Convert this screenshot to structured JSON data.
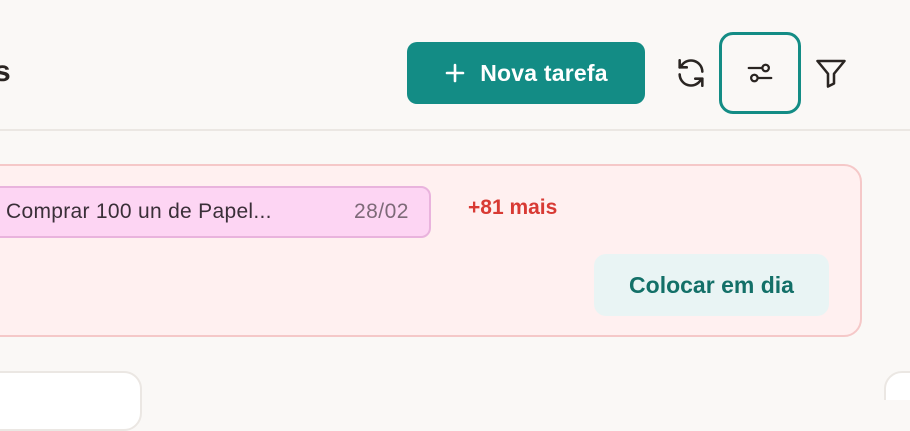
{
  "header": {
    "title_fragment": "s",
    "new_task_label": "Nova tarefa",
    "icons": {
      "plus": "plus-icon",
      "refresh": "refresh-icon",
      "settings": "sliders-icon",
      "filter": "filter-icon"
    },
    "accent_color": "#138c85"
  },
  "overdue": {
    "task": {
      "title": "Comprar 100 un de Papel...",
      "date": "28/02"
    },
    "more_label": "+81 mais",
    "catch_up_label": "Colocar em dia",
    "colors": {
      "panel_bg": "#fff0f0",
      "more": "#d83a34",
      "chip_bg": "#fdd5f3"
    }
  }
}
